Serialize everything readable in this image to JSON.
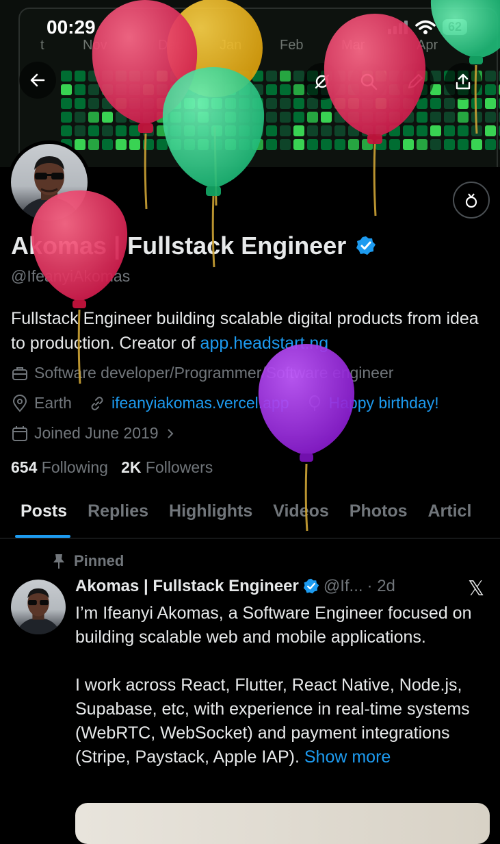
{
  "status": {
    "time": "00:29",
    "battery": "62"
  },
  "banner": {
    "months": [
      "t",
      "Nov",
      "Dec",
      "Jan",
      "Feb",
      "Mar",
      "Apr"
    ],
    "colors": {
      "low": "#0e4429",
      "mid": "#006d32",
      "high": "#26a641",
      "top": "#39d353"
    }
  },
  "icons": {
    "back": "arrow-left-icon",
    "grok": "grok-icon",
    "search": "search-icon",
    "edit": "pencil-icon",
    "share": "share-icon",
    "gift": "gift-icon",
    "verified": "verified-badge-icon",
    "pin": "pin-icon",
    "x": "x-logo-icon",
    "briefcase": "briefcase-icon",
    "location": "location-icon",
    "link": "link-icon",
    "balloon": "balloon-icon",
    "calendar": "calendar-icon"
  },
  "profile": {
    "name": "Akomas | Fullstack Engineer",
    "handle": "@IfeanyiAkomas",
    "bio_text": "Fullstack Engineer building scalable digital products from idea to production. Creator of ",
    "bio_link": "app.headstart.ng",
    "profession": "Software developer/Programmer/Software engineer",
    "location": "Earth",
    "website": "ifeanyiakomas.vercel.app",
    "birthday": "Happy birthday!",
    "joined": "Joined June 2019",
    "following_count": "654",
    "following_label": "Following",
    "followers_count": "2K",
    "followers_label": "Followers"
  },
  "tabs": [
    {
      "label": "Posts",
      "active": true
    },
    {
      "label": "Replies"
    },
    {
      "label": "Highlights"
    },
    {
      "label": "Videos"
    },
    {
      "label": "Photos"
    },
    {
      "label": "Articl"
    }
  ],
  "post": {
    "pinned_label": "Pinned",
    "name": "Akomas | Fullstack Engineer",
    "handle": "@If...",
    "time": "· 2d",
    "para1": "I’m Ifeanyi Akomas, a Software Engineer focused on building scalable web and mobile applications.",
    "para2": "I work across React, Flutter, React Native, Node.js, Supabase, etc, with experience in real-time systems (WebRTC, WebSocket) and payment integrations (Stripe, Paystack, Apple IAP). ",
    "show_more": "Show more"
  }
}
